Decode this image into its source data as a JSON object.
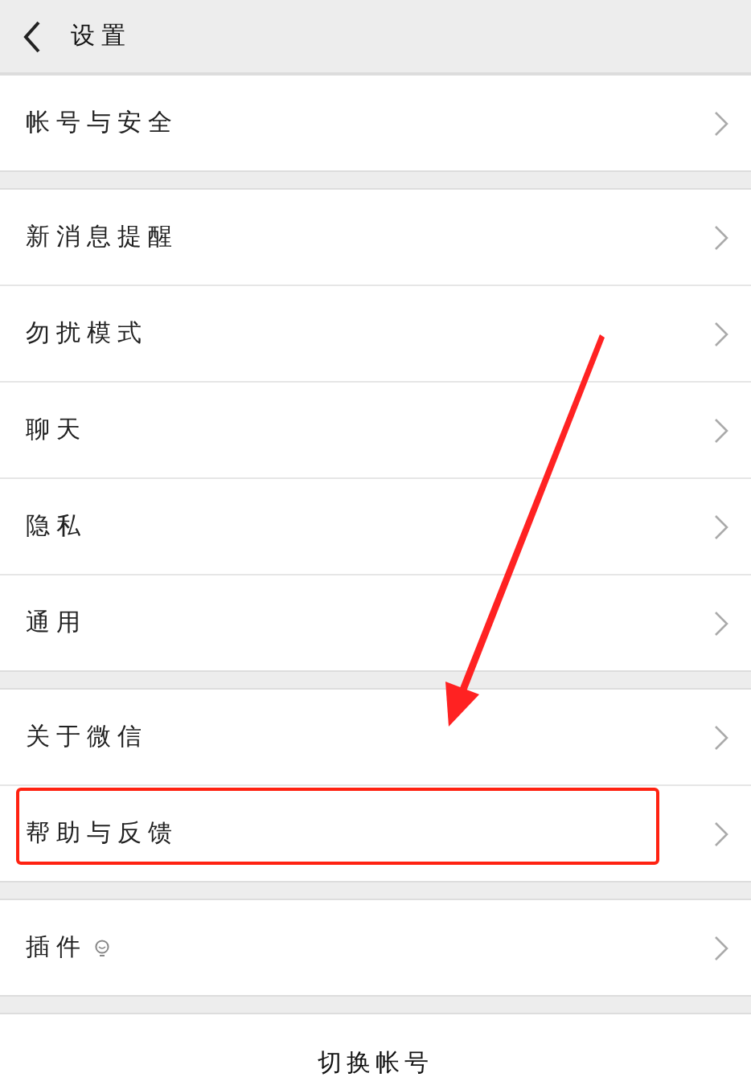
{
  "header": {
    "title": "设置"
  },
  "groups": [
    {
      "items": [
        {
          "label": "帐号与安全",
          "kind": "plain",
          "highlighted": false
        }
      ]
    },
    {
      "items": [
        {
          "label": "新消息提醒",
          "kind": "plain",
          "highlighted": false
        },
        {
          "label": "勿扰模式",
          "kind": "plain",
          "highlighted": false
        },
        {
          "label": "聊天",
          "kind": "plain",
          "highlighted": false
        },
        {
          "label": "隐私",
          "kind": "plain",
          "highlighted": false
        },
        {
          "label": "通用",
          "kind": "plain",
          "highlighted": false
        }
      ]
    },
    {
      "items": [
        {
          "label": "关于微信",
          "kind": "plain",
          "highlighted": false
        },
        {
          "label": "帮助与反馈",
          "kind": "plain",
          "highlighted": true
        }
      ]
    },
    {
      "items": [
        {
          "label": "插件",
          "kind": "with-icon",
          "highlighted": false
        }
      ]
    }
  ],
  "switch_account": "切换帐号"
}
